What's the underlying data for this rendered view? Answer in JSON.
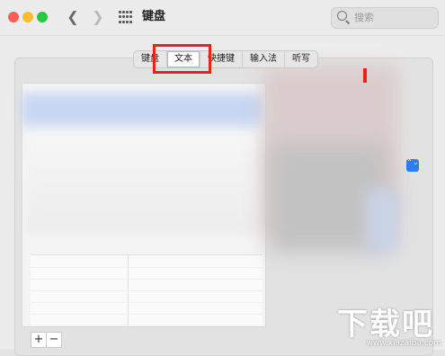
{
  "window": {
    "title": "键盘"
  },
  "search": {
    "placeholder": "搜索"
  },
  "tabs": [
    {
      "label": "键盘",
      "active": false
    },
    {
      "label": "文本",
      "active": true
    },
    {
      "label": "快捷键",
      "active": false
    },
    {
      "label": "输入法",
      "active": false
    },
    {
      "label": "听写",
      "active": false
    }
  ],
  "list_controls": {
    "add_label": "+",
    "remove_label": "−"
  },
  "stepper": {
    "glyph": "⌃⌄"
  },
  "watermark": {
    "text": "下载吧",
    "url": "www.xiazaiba.com"
  },
  "colors": {
    "highlight": "#e3261d",
    "accent": "#2e7cf6"
  }
}
